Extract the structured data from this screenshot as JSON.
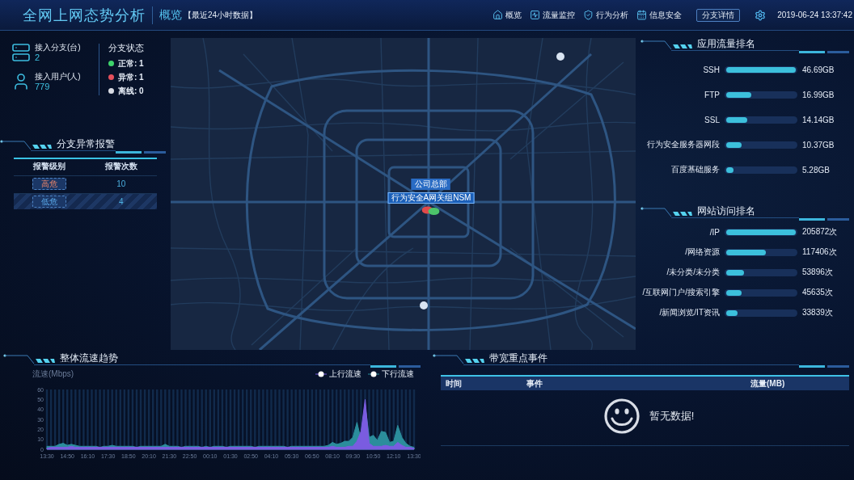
{
  "header": {
    "title": "全网上网态势分析",
    "section": "概览",
    "range": "【最近24小时数据】",
    "nav": [
      "概览",
      "流量监控",
      "行为分析",
      "信息安全"
    ],
    "button": "分支详情",
    "datetime": "2019-06-24 13:37:42"
  },
  "overview": {
    "stats": [
      {
        "label": "接入分支(台)",
        "value": "2"
      },
      {
        "label": "接入用户(人)",
        "value": "779"
      }
    ],
    "status_title": "分支状态",
    "statuses": [
      {
        "label": "正常: 1",
        "color": "#3ed36b"
      },
      {
        "label": "异常: 1",
        "color": "#e5505c"
      },
      {
        "label": "离线: 0",
        "color": "#d9dce4"
      }
    ]
  },
  "alarms": {
    "title": "分支异常报警",
    "columns": [
      "报警级别",
      "报警次数"
    ],
    "rows": [
      {
        "severity": "高危",
        "kind": "high",
        "count": "10"
      },
      {
        "severity": "低危",
        "kind": "low",
        "count": "4"
      }
    ]
  },
  "map": {
    "labels": [
      "公司总部",
      "行为安全A网关组NSM"
    ]
  },
  "app_traffic": {
    "title": "应用流量排名",
    "items": [
      {
        "name": "SSH",
        "level": 1,
        "value": "46.69GB"
      },
      {
        "name": "FTP",
        "level": 0.36,
        "value": "16.99GB"
      },
      {
        "name": "SSL",
        "level": 0.3,
        "value": "14.14GB"
      },
      {
        "name": "行为安全服务器网段",
        "level": 0.22,
        "value": "10.37GB"
      },
      {
        "name": "百度基础服务",
        "level": 0.11,
        "value": "5.28GB"
      }
    ]
  },
  "site_visits": {
    "title": "网站访问排名",
    "items": [
      {
        "name": "/IP",
        "level": 1,
        "value": "205872次"
      },
      {
        "name": "/网络资源",
        "level": 0.57,
        "value": "117406次"
      },
      {
        "name": "/未分类/未分类",
        "level": 0.26,
        "value": "53896次"
      },
      {
        "name": "/互联网门户/搜索引擎",
        "level": 0.22,
        "value": "45635次"
      },
      {
        "name": "/新闻浏览/IT资讯",
        "level": 0.16,
        "value": "33839次"
      }
    ]
  },
  "trend": {
    "title": "整体流速趋势",
    "chart_data": {
      "type": "area",
      "ylabel": "流速(Mbps)",
      "ylim": [
        0,
        60
      ],
      "yticks": [
        0,
        10,
        20,
        30,
        40,
        50,
        60
      ],
      "grid": true,
      "legend": "top-right",
      "categories": [
        "13:30",
        null,
        null,
        null,
        null,
        "14:50",
        null,
        null,
        null,
        null,
        "16:10",
        null,
        null,
        null,
        null,
        "17:30",
        null,
        null,
        null,
        null,
        "18:50",
        null,
        null,
        null,
        null,
        "20:10",
        null,
        null,
        null,
        null,
        "21:30",
        null,
        null,
        null,
        null,
        "22:50",
        null,
        null,
        null,
        null,
        "00:10",
        null,
        null,
        null,
        null,
        "01:30",
        null,
        null,
        null,
        null,
        "02:50",
        null,
        null,
        null,
        null,
        "04:10",
        null,
        null,
        null,
        null,
        "05:30",
        null,
        null,
        null,
        null,
        "06:50",
        null,
        null,
        null,
        null,
        "08:10",
        null,
        null,
        null,
        null,
        "09:30",
        null,
        null,
        null,
        null,
        "10:50",
        null,
        null,
        null,
        null,
        "12:10",
        null,
        null,
        null,
        null,
        "13:30"
      ],
      "series": [
        {
          "name": "上行流速",
          "color": "#7a5ce0",
          "values": [
            1,
            2,
            2,
            2,
            2,
            2,
            3,
            2,
            2,
            2,
            2,
            2,
            2,
            2,
            2,
            2,
            2,
            2,
            2,
            2,
            2,
            2,
            2,
            2,
            2,
            2,
            2,
            2,
            2,
            2,
            2,
            2,
            2,
            2,
            2,
            2,
            2,
            2,
            2,
            2,
            2,
            2,
            2,
            2,
            2,
            2,
            2,
            2,
            2,
            2,
            2,
            2,
            2,
            2,
            2,
            2,
            2,
            2,
            2,
            2,
            2,
            2,
            2,
            2,
            2,
            2,
            2,
            2,
            2,
            2,
            3,
            2,
            2,
            2,
            3,
            3,
            8,
            18,
            50,
            6,
            3,
            3,
            3,
            4,
            3,
            3,
            7,
            4,
            2,
            2,
            1
          ]
        },
        {
          "name": "下行流速",
          "color": "#2b8d9c",
          "values": [
            3,
            3,
            3,
            5,
            6,
            4,
            5,
            4,
            3,
            3,
            3,
            3,
            3,
            2,
            3,
            3,
            4,
            3,
            3,
            3,
            3,
            3,
            2,
            3,
            3,
            3,
            3,
            3,
            3,
            5,
            3,
            3,
            3,
            2,
            3,
            3,
            3,
            3,
            2,
            3,
            2,
            3,
            3,
            3,
            2,
            3,
            3,
            3,
            3,
            3,
            3,
            2,
            3,
            3,
            3,
            3,
            3,
            3,
            3,
            2,
            3,
            3,
            3,
            3,
            3,
            3,
            3,
            3,
            3,
            4,
            7,
            5,
            6,
            8,
            8,
            12,
            27,
            10,
            45,
            12,
            14,
            9,
            18,
            17,
            7,
            8,
            24,
            12,
            6,
            3,
            2
          ]
        }
      ]
    }
  },
  "events": {
    "title": "带宽重点事件",
    "columns": [
      "时间",
      "事件",
      "流量(MB)"
    ],
    "empty_text": "暂无数据!"
  }
}
